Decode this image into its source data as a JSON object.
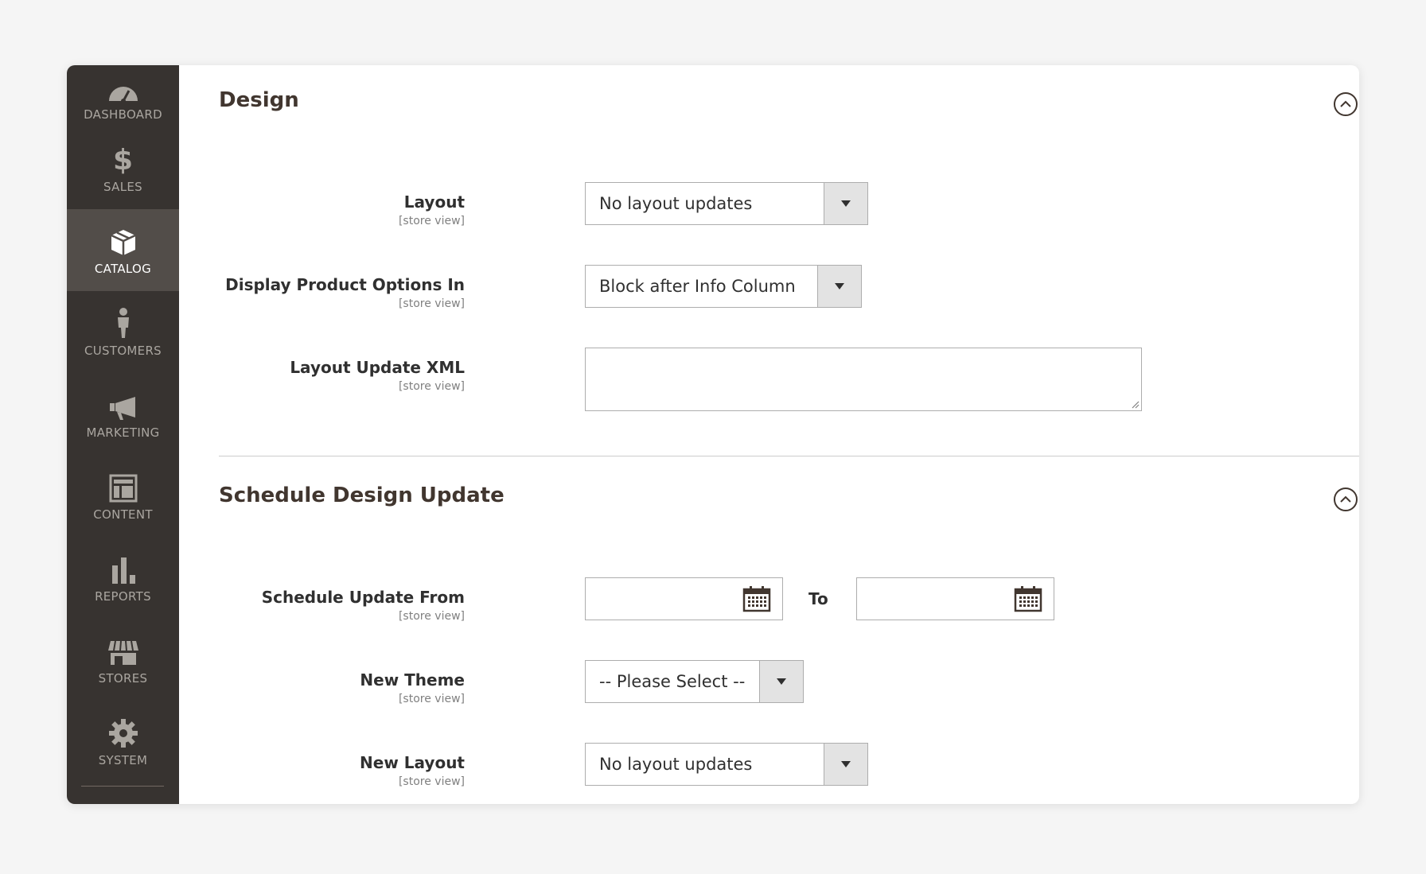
{
  "sidebar": {
    "items": [
      {
        "label": "DASHBOARD",
        "icon": "dashboard-icon"
      },
      {
        "label": "SALES",
        "icon": "dollar-icon"
      },
      {
        "label": "CATALOG",
        "icon": "box-icon",
        "active": true
      },
      {
        "label": "CUSTOMERS",
        "icon": "person-icon"
      },
      {
        "label": "MARKETING",
        "icon": "megaphone-icon"
      },
      {
        "label": "CONTENT",
        "icon": "layout-icon"
      },
      {
        "label": "REPORTS",
        "icon": "bar-chart-icon"
      },
      {
        "label": "STORES",
        "icon": "storefront-icon"
      },
      {
        "label": "SYSTEM",
        "icon": "gear-icon"
      }
    ]
  },
  "design": {
    "title": "Design",
    "fields": {
      "layout": {
        "label": "Layout",
        "scope": "[store view]",
        "value": "No layout updates"
      },
      "display_options": {
        "label": "Display Product Options In",
        "scope": "[store view]",
        "value": "Block after Info Column"
      },
      "layout_xml": {
        "label": "Layout Update XML",
        "scope": "[store view]",
        "value": ""
      }
    }
  },
  "schedule": {
    "title": "Schedule Design Update",
    "fields": {
      "update_from": {
        "label": "Schedule Update From",
        "scope": "[store view]",
        "value": ""
      },
      "to_label": "To",
      "update_to": {
        "value": ""
      },
      "new_theme": {
        "label": "New Theme",
        "scope": "[store view]",
        "value": "-- Please Select --"
      },
      "new_layout": {
        "label": "New Layout",
        "scope": "[store view]",
        "value": "No layout updates"
      }
    }
  },
  "colors": {
    "sidebar_bg": "#373330",
    "sidebar_active_bg": "#524d49",
    "sidebar_text": "#aaa6a0",
    "heading": "#41362f"
  }
}
